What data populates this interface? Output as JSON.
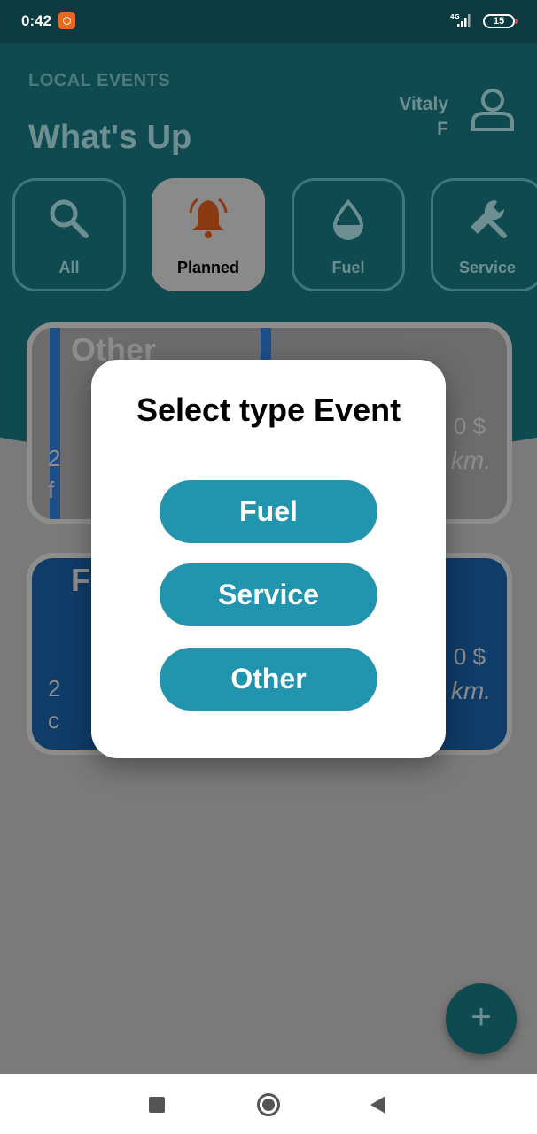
{
  "status_bar": {
    "time": "0:42",
    "network": "4G",
    "battery": "15"
  },
  "header": {
    "label": "LOCAL EVENTS",
    "title": "What's Up",
    "user_first": "Vitaly",
    "user_last": "F"
  },
  "filters": [
    {
      "label": "All",
      "icon": "search-icon"
    },
    {
      "label": "Planned",
      "icon": "bell-icon",
      "active": true
    },
    {
      "label": "Fuel",
      "icon": "drop-icon"
    },
    {
      "label": "Service",
      "icon": "wrench-icon"
    }
  ],
  "cards": [
    {
      "title": "Other",
      "price": "0 $",
      "km": "km.",
      "date": "2",
      "place": "f"
    },
    {
      "title": "F",
      "price": "0 $",
      "km": "km.",
      "date": "2",
      "place": "c"
    }
  ],
  "dialog": {
    "title": "Select type Event",
    "buttons": [
      "Fuel",
      "Service",
      "Other"
    ]
  },
  "fab": {
    "label": "+"
  },
  "colors": {
    "accent": "#2195ad",
    "header": "#0f4a50",
    "bell": "#8a3a12"
  }
}
